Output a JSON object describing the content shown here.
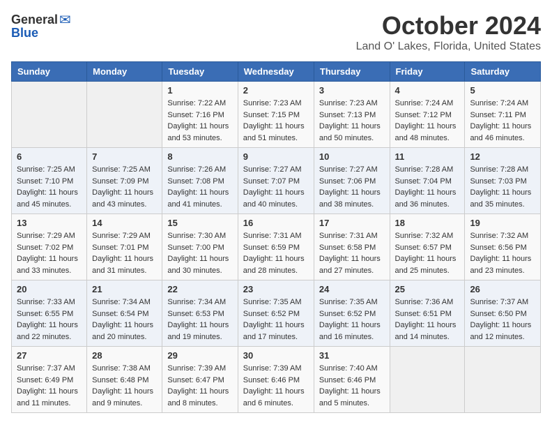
{
  "header": {
    "logo_general": "General",
    "logo_blue": "Blue",
    "title": "October 2024",
    "subtitle": "Land O' Lakes, Florida, United States"
  },
  "days_of_week": [
    "Sunday",
    "Monday",
    "Tuesday",
    "Wednesday",
    "Thursday",
    "Friday",
    "Saturday"
  ],
  "weeks": [
    [
      {
        "day": "",
        "content": ""
      },
      {
        "day": "",
        "content": ""
      },
      {
        "day": "1",
        "sunrise": "Sunrise: 7:22 AM",
        "sunset": "Sunset: 7:16 PM",
        "daylight": "Daylight: 11 hours and 53 minutes."
      },
      {
        "day": "2",
        "sunrise": "Sunrise: 7:23 AM",
        "sunset": "Sunset: 7:15 PM",
        "daylight": "Daylight: 11 hours and 51 minutes."
      },
      {
        "day": "3",
        "sunrise": "Sunrise: 7:23 AM",
        "sunset": "Sunset: 7:13 PM",
        "daylight": "Daylight: 11 hours and 50 minutes."
      },
      {
        "day": "4",
        "sunrise": "Sunrise: 7:24 AM",
        "sunset": "Sunset: 7:12 PM",
        "daylight": "Daylight: 11 hours and 48 minutes."
      },
      {
        "day": "5",
        "sunrise": "Sunrise: 7:24 AM",
        "sunset": "Sunset: 7:11 PM",
        "daylight": "Daylight: 11 hours and 46 minutes."
      }
    ],
    [
      {
        "day": "6",
        "sunrise": "Sunrise: 7:25 AM",
        "sunset": "Sunset: 7:10 PM",
        "daylight": "Daylight: 11 hours and 45 minutes."
      },
      {
        "day": "7",
        "sunrise": "Sunrise: 7:25 AM",
        "sunset": "Sunset: 7:09 PM",
        "daylight": "Daylight: 11 hours and 43 minutes."
      },
      {
        "day": "8",
        "sunrise": "Sunrise: 7:26 AM",
        "sunset": "Sunset: 7:08 PM",
        "daylight": "Daylight: 11 hours and 41 minutes."
      },
      {
        "day": "9",
        "sunrise": "Sunrise: 7:27 AM",
        "sunset": "Sunset: 7:07 PM",
        "daylight": "Daylight: 11 hours and 40 minutes."
      },
      {
        "day": "10",
        "sunrise": "Sunrise: 7:27 AM",
        "sunset": "Sunset: 7:06 PM",
        "daylight": "Daylight: 11 hours and 38 minutes."
      },
      {
        "day": "11",
        "sunrise": "Sunrise: 7:28 AM",
        "sunset": "Sunset: 7:04 PM",
        "daylight": "Daylight: 11 hours and 36 minutes."
      },
      {
        "day": "12",
        "sunrise": "Sunrise: 7:28 AM",
        "sunset": "Sunset: 7:03 PM",
        "daylight": "Daylight: 11 hours and 35 minutes."
      }
    ],
    [
      {
        "day": "13",
        "sunrise": "Sunrise: 7:29 AM",
        "sunset": "Sunset: 7:02 PM",
        "daylight": "Daylight: 11 hours and 33 minutes."
      },
      {
        "day": "14",
        "sunrise": "Sunrise: 7:29 AM",
        "sunset": "Sunset: 7:01 PM",
        "daylight": "Daylight: 11 hours and 31 minutes."
      },
      {
        "day": "15",
        "sunrise": "Sunrise: 7:30 AM",
        "sunset": "Sunset: 7:00 PM",
        "daylight": "Daylight: 11 hours and 30 minutes."
      },
      {
        "day": "16",
        "sunrise": "Sunrise: 7:31 AM",
        "sunset": "Sunset: 6:59 PM",
        "daylight": "Daylight: 11 hours and 28 minutes."
      },
      {
        "day": "17",
        "sunrise": "Sunrise: 7:31 AM",
        "sunset": "Sunset: 6:58 PM",
        "daylight": "Daylight: 11 hours and 27 minutes."
      },
      {
        "day": "18",
        "sunrise": "Sunrise: 7:32 AM",
        "sunset": "Sunset: 6:57 PM",
        "daylight": "Daylight: 11 hours and 25 minutes."
      },
      {
        "day": "19",
        "sunrise": "Sunrise: 7:32 AM",
        "sunset": "Sunset: 6:56 PM",
        "daylight": "Daylight: 11 hours and 23 minutes."
      }
    ],
    [
      {
        "day": "20",
        "sunrise": "Sunrise: 7:33 AM",
        "sunset": "Sunset: 6:55 PM",
        "daylight": "Daylight: 11 hours and 22 minutes."
      },
      {
        "day": "21",
        "sunrise": "Sunrise: 7:34 AM",
        "sunset": "Sunset: 6:54 PM",
        "daylight": "Daylight: 11 hours and 20 minutes."
      },
      {
        "day": "22",
        "sunrise": "Sunrise: 7:34 AM",
        "sunset": "Sunset: 6:53 PM",
        "daylight": "Daylight: 11 hours and 19 minutes."
      },
      {
        "day": "23",
        "sunrise": "Sunrise: 7:35 AM",
        "sunset": "Sunset: 6:52 PM",
        "daylight": "Daylight: 11 hours and 17 minutes."
      },
      {
        "day": "24",
        "sunrise": "Sunrise: 7:35 AM",
        "sunset": "Sunset: 6:52 PM",
        "daylight": "Daylight: 11 hours and 16 minutes."
      },
      {
        "day": "25",
        "sunrise": "Sunrise: 7:36 AM",
        "sunset": "Sunset: 6:51 PM",
        "daylight": "Daylight: 11 hours and 14 minutes."
      },
      {
        "day": "26",
        "sunrise": "Sunrise: 7:37 AM",
        "sunset": "Sunset: 6:50 PM",
        "daylight": "Daylight: 11 hours and 12 minutes."
      }
    ],
    [
      {
        "day": "27",
        "sunrise": "Sunrise: 7:37 AM",
        "sunset": "Sunset: 6:49 PM",
        "daylight": "Daylight: 11 hours and 11 minutes."
      },
      {
        "day": "28",
        "sunrise": "Sunrise: 7:38 AM",
        "sunset": "Sunset: 6:48 PM",
        "daylight": "Daylight: 11 hours and 9 minutes."
      },
      {
        "day": "29",
        "sunrise": "Sunrise: 7:39 AM",
        "sunset": "Sunset: 6:47 PM",
        "daylight": "Daylight: 11 hours and 8 minutes."
      },
      {
        "day": "30",
        "sunrise": "Sunrise: 7:39 AM",
        "sunset": "Sunset: 6:46 PM",
        "daylight": "Daylight: 11 hours and 6 minutes."
      },
      {
        "day": "31",
        "sunrise": "Sunrise: 7:40 AM",
        "sunset": "Sunset: 6:46 PM",
        "daylight": "Daylight: 11 hours and 5 minutes."
      },
      {
        "day": "",
        "content": ""
      },
      {
        "day": "",
        "content": ""
      }
    ]
  ]
}
